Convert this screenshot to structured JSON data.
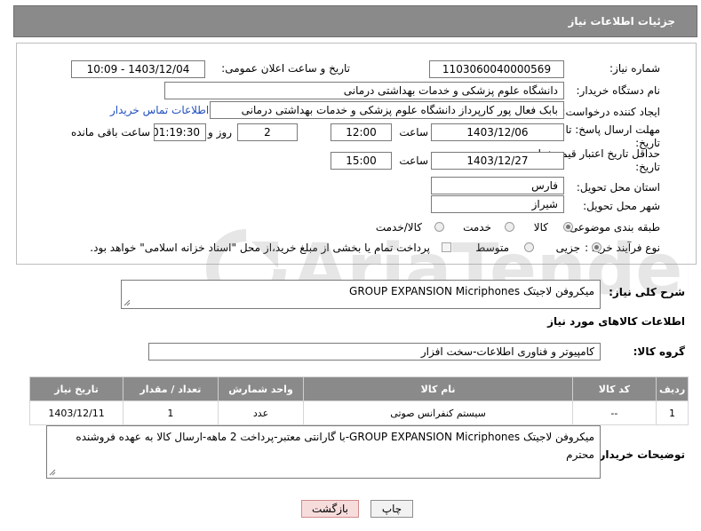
{
  "header": {
    "title": "جزئیات اطلاعات نیاز"
  },
  "form": {
    "need_number_label": "شماره نیاز:",
    "need_number": "1103060040000569",
    "announce_label": "تاریخ و ساعت اعلان عمومی:",
    "announce_value": "1403/12/04 - 10:09",
    "buyer_org_label": "نام دستگاه خریدار:",
    "buyer_org": "دانشگاه علوم پزشکی و خدمات بهداشتی درمانی",
    "creator_label": "ایجاد کننده درخواست:",
    "creator": "بابک فعال پور کارپرداز دانشگاه علوم پزشکی و خدمات بهداشتی درمانی",
    "buyer_contact_link": "اطلاعات تماس خریدار",
    "deadline_label_1": "مهلت ارسال پاسخ: تا",
    "deadline_label_2": "تاریخ:",
    "deadline_date": "1403/12/06",
    "time_label": "ساعت",
    "deadline_time": "12:00",
    "days_value": "2",
    "days_label": "روز و",
    "remaining_time": "01:19:30",
    "remaining_label": "ساعت باقی مانده",
    "validity_label_1": "حداقل تاریخ اعتبار قیمت: تا",
    "validity_label_2": "تاریخ:",
    "validity_date": "1403/12/27",
    "validity_time_label": "ساعت",
    "validity_time": "15:00",
    "province_label": "استان محل تحویل:",
    "province": "فارس",
    "city_label": "شهر محل تحویل:",
    "city": "شیراز",
    "category_label": "طبقه بندی موضوعی:",
    "category_options": [
      "کالا",
      "خدمت",
      "کالا/خدمت"
    ],
    "category_selected": "کالا",
    "process_label": "نوع فرآیند خرید :",
    "process_options": [
      "جزیی",
      "متوسط"
    ],
    "process_selected": "جزیی",
    "payment_note": "پرداخت تمام یا بخشی از مبلغ خرید،از محل \"اسناد خزانه اسلامی\" خواهد بود."
  },
  "summary": {
    "label": "شرح کلی نیاز:",
    "value": "میکروفن لاجیتک GROUP EXPANSION Micriphones"
  },
  "goods_section": {
    "title": "اطلاعات کالاهای مورد نیاز",
    "group_label": "گروه کالا:",
    "group_value": "کامپیوتر و فناوری اطلاعات-سخت افزار"
  },
  "table": {
    "headers": [
      "ردیف",
      "کد کالا",
      "نام کالا",
      "واحد شمارش",
      "تعداد / مقدار",
      "تاریخ نیاز"
    ],
    "rows": [
      [
        "1",
        "--",
        "سیستم کنفرانس صوتی",
        "عدد",
        "1",
        "1403/12/11"
      ]
    ]
  },
  "buyer_notes": {
    "label": "توضیحات خریدار:",
    "value": "میکروفن لاجیتک  GROUP EXPANSION Micriphones-با گارانتی معتبر-پرداخت 2 ماهه-ارسال کالا به عهده فروشنده محترم"
  },
  "buttons": {
    "print": "چاپ",
    "back": "بازگشت"
  },
  "watermark": {
    "text": "AriaTender.net"
  },
  "colors": {
    "header_bg": "#8a8a8a",
    "link": "#1f4fbf",
    "back_button_bg": "#f7dcdc",
    "back_button_border": "#d28a8a"
  }
}
